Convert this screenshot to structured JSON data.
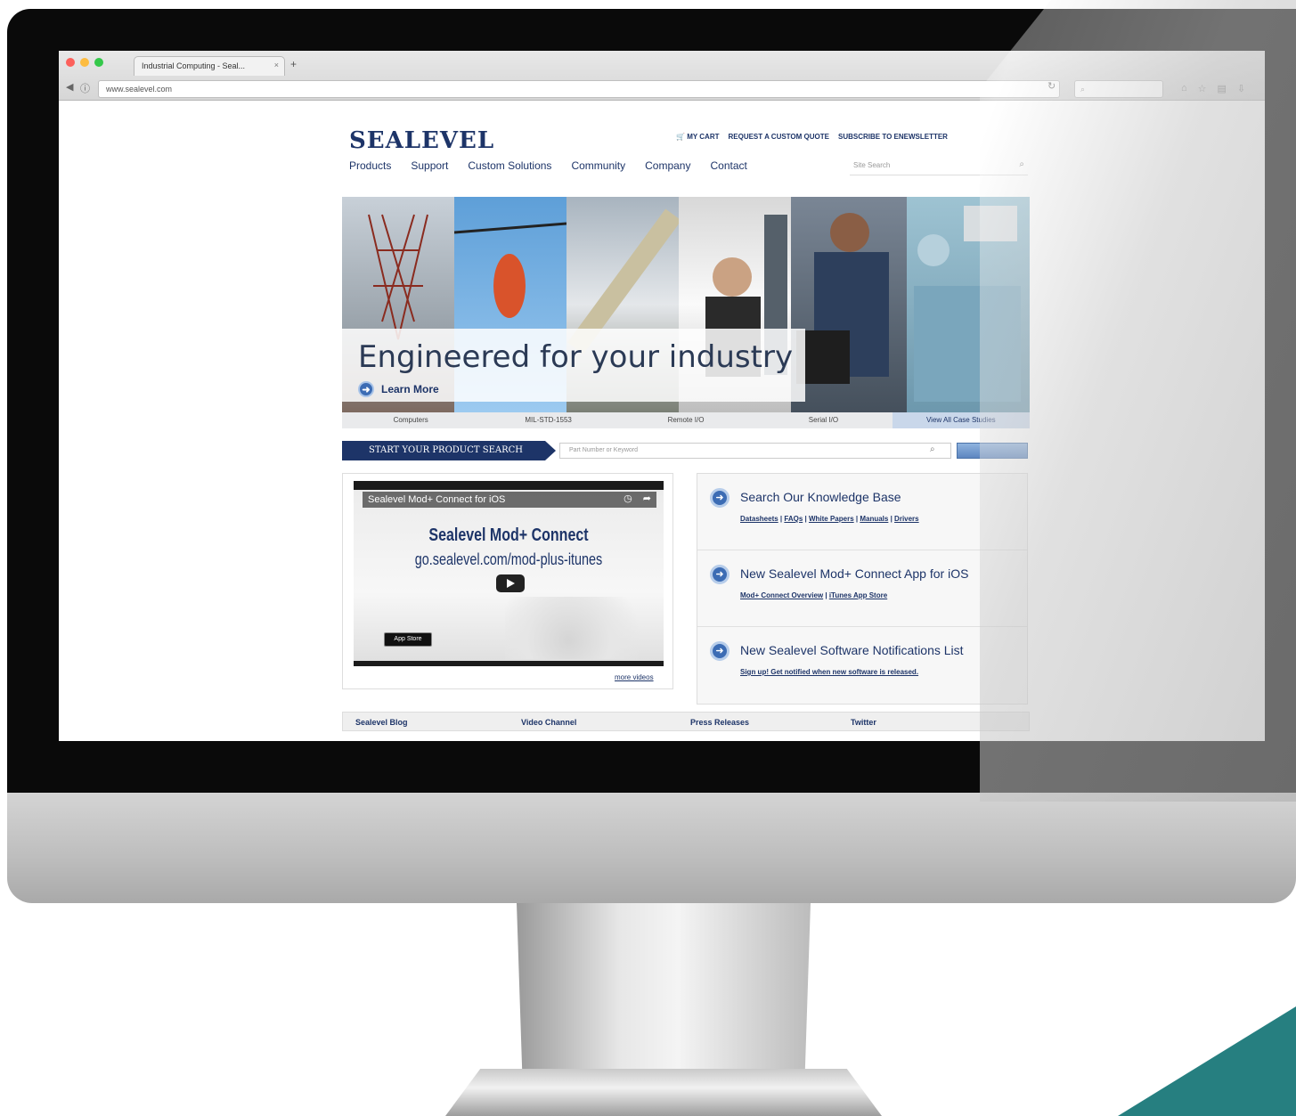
{
  "browser": {
    "tab_title": "Industrial Computing - Seal...",
    "tab_close": "×",
    "new_tab": "+",
    "url": "www.sealevel.com"
  },
  "site": {
    "logo": "SEALEVEL",
    "util_links": [
      "MY CART",
      "REQUEST A CUSTOM QUOTE",
      "SUBSCRIBE TO ENEWSLETTER"
    ],
    "nav": [
      "Products",
      "Support",
      "Custom Solutions",
      "Community",
      "Company",
      "Contact"
    ],
    "nav_search_placeholder": "Site Search"
  },
  "hero": {
    "title": "Engineered for your industry",
    "learn_more": "Learn More",
    "case_studies": [
      "Computers",
      "MIL-STD-1553",
      "Remote I/O",
      "Serial I/O",
      "View All Case Studies"
    ]
  },
  "product_search": {
    "label": "START YOUR PRODUCT SEARCH",
    "placeholder": "Part Number or Keyword"
  },
  "video": {
    "title": "Sealevel Mod+ Connect for iOS",
    "line1": "Sealevel Mod+ Connect",
    "line2": "go.sealevel.com/mod-plus-itunes",
    "appstore": "App Store",
    "more_videos": "more videos"
  },
  "knowledge": [
    {
      "title": "Search Our Knowledge Base",
      "links": [
        "Datasheets",
        "FAQs",
        "White Papers",
        "Manuals",
        "Drivers"
      ]
    },
    {
      "title": "New Sealevel Mod+ Connect App for iOS",
      "links": [
        "Mod+ Connect Overview",
        "iTunes App Store"
      ]
    },
    {
      "title": "New Sealevel Software Notifications List",
      "links": [
        "Sign up! Get notified when new software is released."
      ]
    }
  ],
  "social": [
    "Sealevel Blog",
    "Video Channel",
    "Press Releases",
    "Twitter"
  ],
  "colors": {
    "brand": "#1d3468",
    "accent": "#3c6cb4",
    "teal": "#267f80"
  }
}
